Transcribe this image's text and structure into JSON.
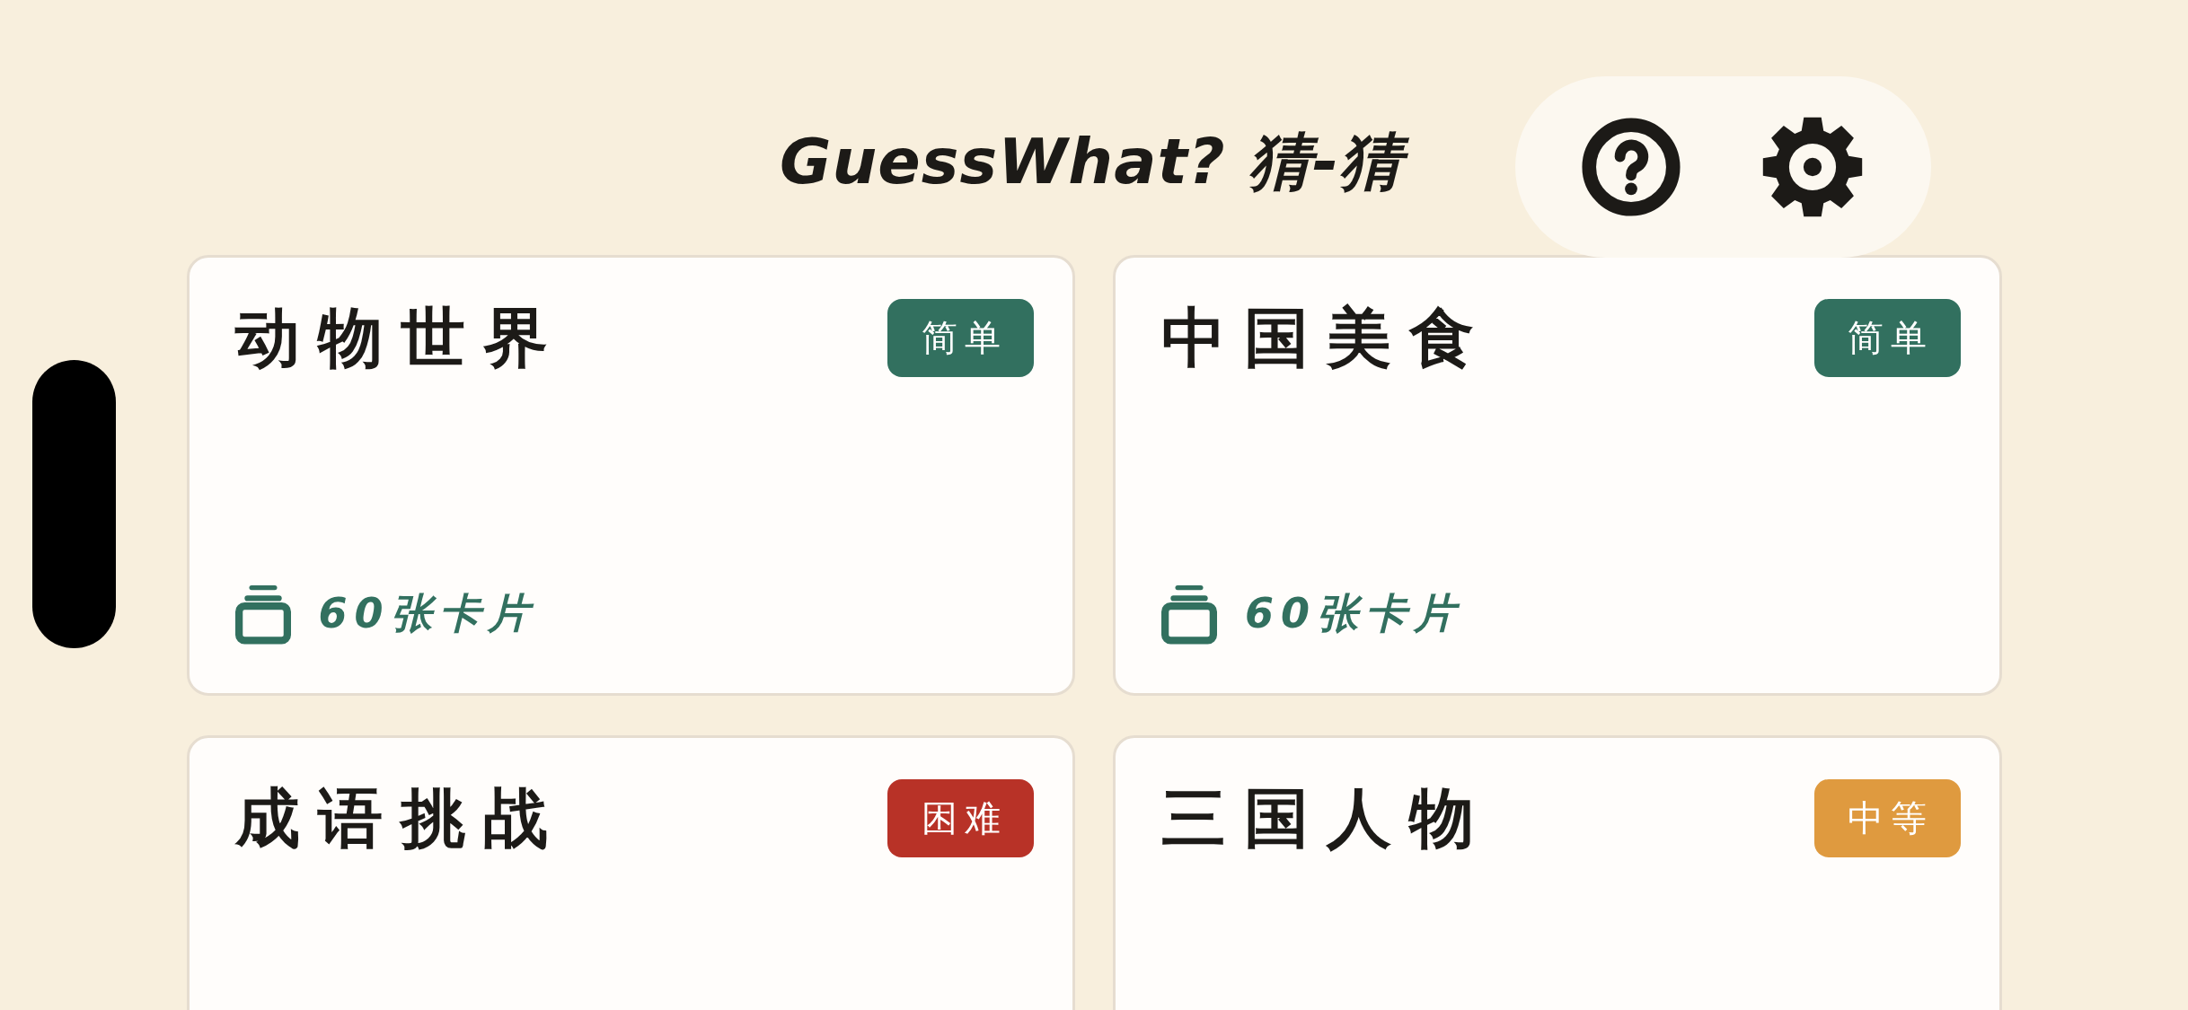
{
  "header": {
    "title": "GuessWhat? 猜-猜"
  },
  "categories": [
    {
      "title": "动物世界",
      "difficulty": "简单",
      "color": "#32705f",
      "card_count": "60张卡片"
    },
    {
      "title": "中国美食",
      "difficulty": "简单",
      "color": "#32705f",
      "card_count": "60张卡片"
    },
    {
      "title": "成语挑战",
      "difficulty": "困难",
      "color": "#b83227"
    },
    {
      "title": "三国人物",
      "difficulty": "中等",
      "color": "#df9a3f"
    }
  ]
}
